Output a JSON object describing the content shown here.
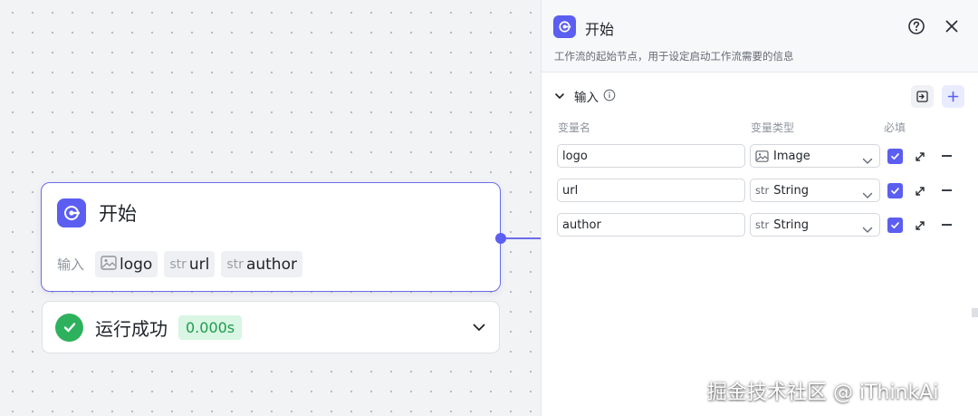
{
  "node": {
    "title": "开始",
    "inputs_label": "输入",
    "tags": [
      {
        "type_icon": "image-icon",
        "name": "logo"
      },
      {
        "type_icon": "str",
        "name": "url"
      },
      {
        "type_icon": "str",
        "name": "author"
      }
    ]
  },
  "run_status": {
    "text": "运行成功",
    "duration": "0.000s"
  },
  "panel": {
    "title": "开始",
    "description": "工作流的起始节点，用于设定启动工作流需要的信息",
    "section_title": "输入",
    "columns": {
      "name": "变量名",
      "type": "变量类型",
      "required": "必填"
    },
    "variables": [
      {
        "name": "logo",
        "type_icon": "image-icon",
        "type": "Image",
        "required": true
      },
      {
        "name": "url",
        "type_icon": "str",
        "type": "String",
        "required": true
      },
      {
        "name": "author",
        "type_icon": "str",
        "type": "String",
        "required": true
      }
    ]
  },
  "watermark": "掘金技术社区 @ iThinkAi",
  "colors": {
    "accent": "#5b5ef0",
    "success": "#2eb15d",
    "success_bg": "#d9f5e3"
  }
}
